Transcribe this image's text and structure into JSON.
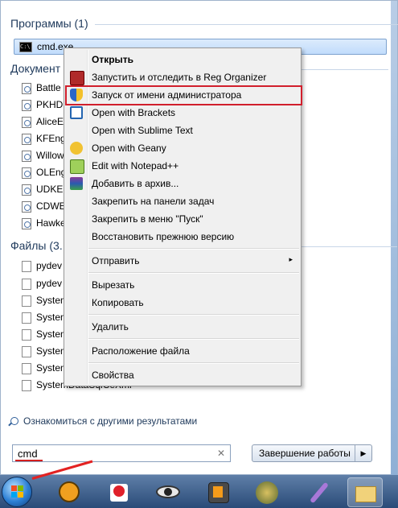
{
  "sections": {
    "programs": "Программы (1)",
    "documents": "Документ",
    "files": "Файлы (3..."
  },
  "program_result": "cmd.exe",
  "documents": [
    "Battle",
    "PKHD",
    "AliceE",
    "KFEng",
    "Willow",
    "OLEng",
    "UDKEr",
    "CDWE",
    "Hawke"
  ],
  "files": [
    "pydev",
    "pydev",
    "System",
    "System",
    "System",
    "System",
    "System",
    "SystemDataSqlCeXml"
  ],
  "more_results": "Ознакомиться с другими результатами",
  "search": {
    "value": "cmd",
    "clear": "✕"
  },
  "shutdown": {
    "label": "Завершение работы",
    "arrow": "▶"
  },
  "context_menu": {
    "open": "Открыть",
    "reg_organizer": "Запустить и отследить в Reg Organizer",
    "run_as_admin": "Запуск от имени администратора",
    "brackets": "Open with Brackets",
    "sublime": "Open with Sublime Text",
    "geany": "Open with Geany",
    "notepadpp": "Edit with Notepad++",
    "archive": "Добавить в архив...",
    "pin_taskbar": "Закрепить на панели задач",
    "pin_start": "Закрепить в меню \"Пуск\"",
    "restore": "Восстановить прежнюю версию",
    "send_to": "Отправить",
    "send_arrow": "▸",
    "cut": "Вырезать",
    "copy": "Копировать",
    "delete": "Удалить",
    "location": "Расположение файла",
    "properties": "Свойства"
  },
  "colors": {
    "highlight": "#d11f2c",
    "section_title": "#1e395b",
    "taskbar": "#2a4b78"
  }
}
